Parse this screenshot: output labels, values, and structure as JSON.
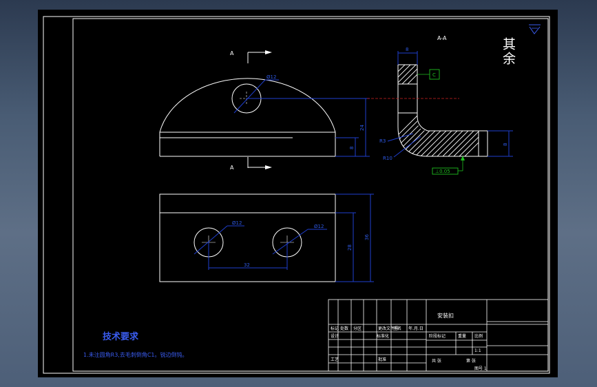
{
  "colors": {
    "background_gradient": [
      "#2c3a50",
      "#5e6f86"
    ],
    "sheet": "#000000",
    "outline": "#ffffff",
    "dimension": "#1f3fd0",
    "centerline_red": "#d02020",
    "annotation_green": "#1fc01f",
    "notes_blue": "#3a5cf0"
  },
  "section_label": "A-A",
  "surface_finish": {
    "text": "其余",
    "symbol_icon": "surface-roughness-icon"
  },
  "cut_labels": {
    "top": "A",
    "bottom": "A"
  },
  "dimensions": {
    "top_hole": "Ø12",
    "height_total": "24",
    "height_base": "8",
    "section_thickness": "8",
    "section_flange": "8",
    "inner_radius": "R3",
    "outer_radius": "R10",
    "datum_box": "C",
    "tolerance_frame": "⊥0.05",
    "bottom_hole_left": "Ø12",
    "bottom_hole_right": "Ø12",
    "hole_spacing": "32",
    "height_inner": "28",
    "height_outer": "36"
  },
  "tech_notes": {
    "title": "技术要求",
    "line1": "1.未注圆角R3,去毛刺倒角C1。锐边倒钝。"
  },
  "title_block": {
    "part_name": "安装扣",
    "row_a": [
      "标记",
      "处数",
      "分区",
      "更改文件号",
      "签名",
      "年.月.日"
    ],
    "row_b": [
      "设计",
      "",
      "标准化"
    ],
    "row_c": [
      "工艺",
      "",
      "批准"
    ],
    "stage_label": "阶段标记",
    "weight_label": "重量",
    "scale_label": "比例",
    "scale_value": "1:1",
    "sheet_total": "共 张",
    "sheet_index": "第 张",
    "footer_mark": "图号 1"
  }
}
